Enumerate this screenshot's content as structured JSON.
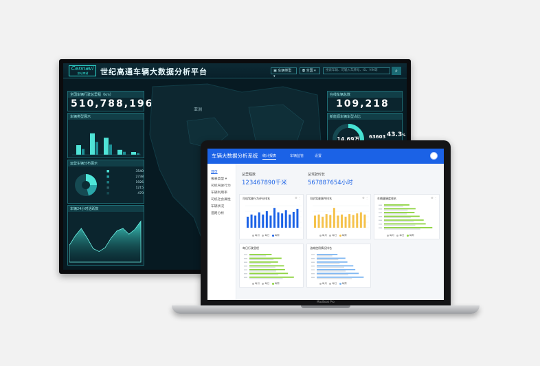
{
  "monitor": {
    "logo": "Cennavi",
    "logo_sub": "世纪高通",
    "title": "世纪高通车辆大数据分析平台",
    "filter_vehicle": "车辆类型",
    "filter_region": "全国",
    "search_placeholder": "搜索车辆、可输入车牌号、ID、VIN等",
    "panel_total_mileage": "全国车辆行驶总里程（km）",
    "total_mileage": "510,788,196",
    "panel_online": "在线车辆总数",
    "online_count": "109,218",
    "panel_vehicle_type": "车辆类型展示",
    "panel_fleet_share": "运营车辆分布展示",
    "panel_new_energy": "新能源车辆车型占比",
    "ring_value": "14.69万",
    "ring_stat_value": "63603",
    "ring_percent": "43.3",
    "ring_percent_unit": "%",
    "panel_daily": "车辆24小时活跃数",
    "map_label": "亚洲",
    "bar_values": [
      0.35,
      0.78,
      0.62,
      0.18,
      0.1
    ],
    "area_values": [
      0.35,
      0.55,
      0.7,
      0.5,
      0.28,
      0.22,
      0.3,
      0.5,
      0.65,
      0.7,
      0.58,
      0.68,
      0.85
    ],
    "pie_rows": [
      "3540",
      "2738",
      "1926",
      "1215",
      "470"
    ]
  },
  "laptop": {
    "app_title": "车辆大数据分析系统",
    "tabs": [
      "统计报表",
      "车辆监管",
      "设置"
    ],
    "side_items": [
      "首页",
      "报表类型",
      "司机驾驶行为",
      "车辆利用率",
      "司机社会属性",
      "车辆状况",
      "道路分析"
    ],
    "stat1_label": "总里程数",
    "stat1_value": "123467890千米",
    "stat2_label": "总驾驶时长",
    "stat2_value": "567887654小时",
    "card1_title": "司机驾驶行为评分排名",
    "card2_title": "司机驾驶事件排名",
    "card3_title": "车辆健康度排名",
    "card4_title": "每日行驶里程",
    "card5_title": "油耗使用情况排名",
    "legend": [
      "每月",
      "每日",
      "每周"
    ],
    "card1_bars": [
      0.5,
      0.6,
      0.55,
      0.7,
      0.6,
      0.75,
      0.55,
      0.9,
      0.7,
      0.65,
      0.8,
      0.6,
      0.72,
      0.85
    ],
    "card2_bars": [
      0.55,
      0.6,
      0.5,
      0.62,
      0.58,
      0.9,
      0.55,
      0.6,
      0.5,
      0.62,
      0.58,
      0.65,
      0.7,
      0.6
    ],
    "card3_bars": [
      0.5,
      0.62,
      0.6,
      0.7,
      0.78,
      0.82,
      0.95
    ],
    "card4_bars": [
      0.45,
      0.65,
      0.58,
      0.7,
      0.72,
      0.78,
      0.9
    ],
    "card5_bars": [
      0.42,
      0.58,
      0.62,
      0.74,
      0.78,
      0.85,
      0.95
    ],
    "colors": {
      "blue": "#1b62e6",
      "green": "#8fd442",
      "yellow": "#f5c24b",
      "sky": "#7fb7f2"
    }
  },
  "base_label": "MacBook Pro"
}
